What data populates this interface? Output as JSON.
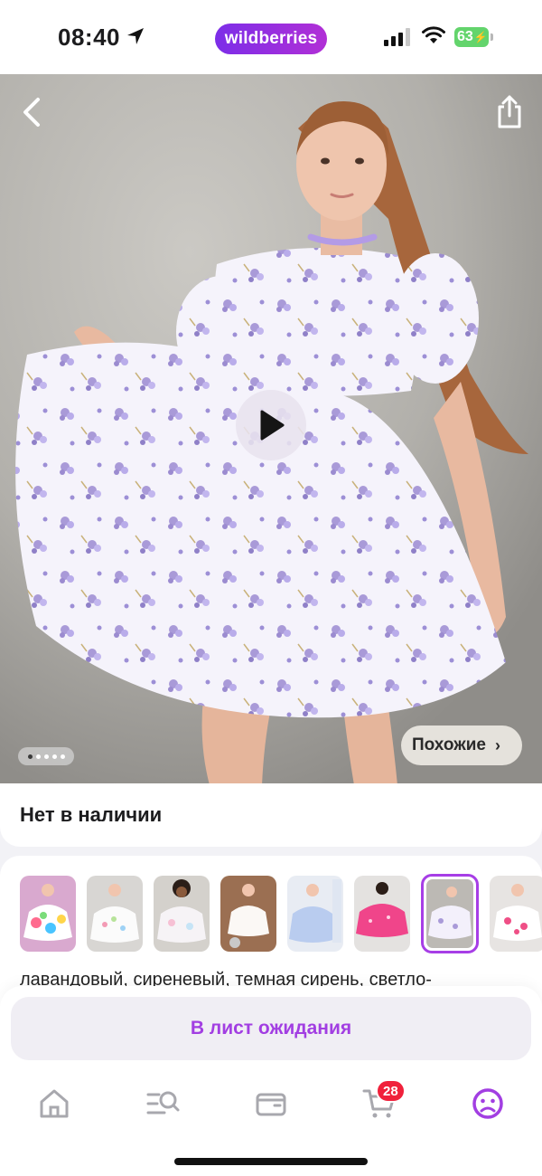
{
  "status_bar": {
    "time": "08:40",
    "brand": "wildberries",
    "battery": "63"
  },
  "hero": {
    "similar_label": "Похожие",
    "pager_total": 5,
    "pager_active": 1
  },
  "product": {
    "availability": "Нет в наличии",
    "color_thumbnails": [
      {
        "name": "rainbow-dress",
        "selected": false
      },
      {
        "name": "white-dress-floral",
        "selected": false
      },
      {
        "name": "pastel-dress-curly",
        "selected": false
      },
      {
        "name": "white-dress-disco",
        "selected": false
      },
      {
        "name": "blue-dress-poster",
        "selected": false
      },
      {
        "name": "pink-sequin-dress",
        "selected": false
      },
      {
        "name": "lavender-floral-dress",
        "selected": true
      },
      {
        "name": "pink-heart-dress",
        "selected": false
      }
    ],
    "color_description": "лавандовый, сиреневый, темная сирень, светло-"
  },
  "action": {
    "waitlist_label": "В лист ожидания"
  },
  "tabbar": {
    "cart_count": "28",
    "active_tab": "profile"
  },
  "colors": {
    "accent": "#a23ee2",
    "badge": "#f0213b",
    "brand_gradient_start": "#7c2ee8",
    "brand_gradient_end": "#b12fd6"
  }
}
